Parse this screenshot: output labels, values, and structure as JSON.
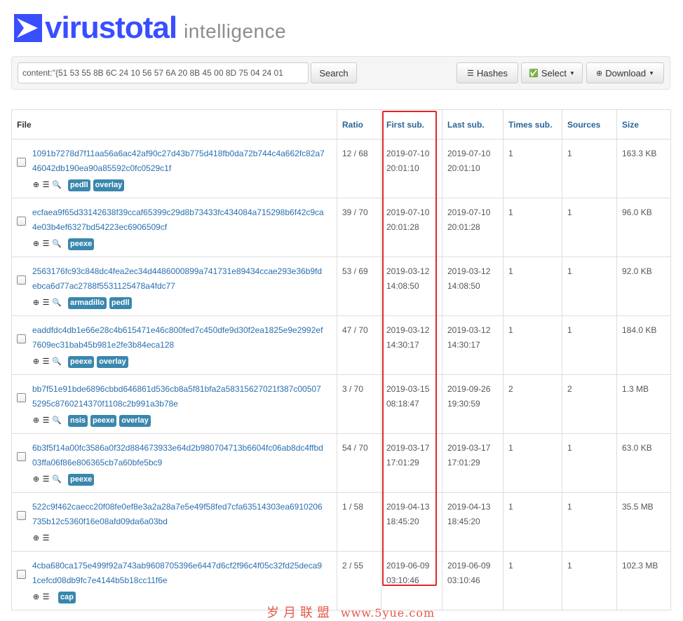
{
  "brand": {
    "name_part1": "virus",
    "name_part2": "total",
    "product": "intelligence",
    "colors": {
      "primary": "#394EFF",
      "secondary": "#8c8c8c"
    }
  },
  "search": {
    "query": "content:\"{51 53 55 8B 6C 24 10 56 57 6A 20 8B 45 00 8D 75 04 24 01",
    "button_label": "Search"
  },
  "toolbar": {
    "hashes_label": "Hashes",
    "select_label": "Select",
    "download_label": "Download"
  },
  "table": {
    "headers": {
      "file": "File",
      "ratio": "Ratio",
      "first_sub": "First sub.",
      "last_sub": "Last sub.",
      "times_sub": "Times sub.",
      "sources": "Sources",
      "size": "Size"
    },
    "rows": [
      {
        "hash": "1091b7278d7f11aa56a6ac42af90c27d43b775d418fb0da72b744c4a662fc82a746042db190ea90a85592c0fc0529c1f",
        "tags": [
          "pedll",
          "overlay"
        ],
        "has_search": true,
        "ratio": "12 / 68",
        "first_date": "2019-07-10",
        "first_time": "20:01:10",
        "last_date": "2019-07-10",
        "last_time": "20:01:10",
        "times": "1",
        "sources": "1",
        "size": "163.3 KB"
      },
      {
        "hash": "ecfaea9f65d33142638f39ccaf65399c29d8b73433fc434084a715298b6f42c9ca4e03b4ef6327bd54223ec6906509cf",
        "tags": [
          "peexe"
        ],
        "has_search": true,
        "ratio": "39 / 70",
        "first_date": "2019-07-10",
        "first_time": "20:01:28",
        "last_date": "2019-07-10",
        "last_time": "20:01:28",
        "times": "1",
        "sources": "1",
        "size": "96.0 KB"
      },
      {
        "hash": "2563176fc93c848dc4fea2ec34d4486000899a741731e89434ccae293e36b9fdebca6d77ac2788f5531125478a4fdc77",
        "tags": [
          "armadillo",
          "pedll"
        ],
        "has_search": true,
        "ratio": "53 / 69",
        "first_date": "2019-03-12",
        "first_time": "14:08:50",
        "last_date": "2019-03-12",
        "last_time": "14:08:50",
        "times": "1",
        "sources": "1",
        "size": "92.0 KB"
      },
      {
        "hash": "eaddfdc4db1e66e28c4b615471e46c800fed7c450dfe9d30f2ea1825e9e2992ef7609ec31bab45b981e2fe3b84eca128",
        "tags": [
          "peexe",
          "overlay"
        ],
        "has_search": true,
        "ratio": "47 / 70",
        "first_date": "2019-03-12",
        "first_time": "14:30:17",
        "last_date": "2019-03-12",
        "last_time": "14:30:17",
        "times": "1",
        "sources": "1",
        "size": "184.0 KB"
      },
      {
        "hash": "bb7f51e91bde6896cbbd646861d536cb8a5f81bfa2a58315627021f387c005075295c8760214370f1108c2b991a3b78e",
        "tags": [
          "nsis",
          "peexe",
          "overlay"
        ],
        "has_search": true,
        "ratio": "3 / 70",
        "first_date": "2019-03-15",
        "first_time": "08:18:47",
        "last_date": "2019-09-26",
        "last_time": "19:30:59",
        "times": "2",
        "sources": "2",
        "size": "1.3 MB"
      },
      {
        "hash": "6b3f5f14a00fc3586a0f32d884673933e64d2b980704713b6604fc06ab8dc4ffbd03ffa06f86e806365cb7a60bfe5bc9",
        "tags": [
          "peexe"
        ],
        "has_search": true,
        "ratio": "54 / 70",
        "first_date": "2019-03-17",
        "first_time": "17:01:29",
        "last_date": "2019-03-17",
        "last_time": "17:01:29",
        "times": "1",
        "sources": "1",
        "size": "63.0 KB"
      },
      {
        "hash": "522c9f462caecc20f08fe0ef8e3a2a28a7e5e49f58fed7cfa63514303ea6910206735b12c5360f16e08afd09da6a03bd",
        "tags": [],
        "has_search": false,
        "ratio": "1 / 58",
        "first_date": "2019-04-13",
        "first_time": "18:45:20",
        "last_date": "2019-04-13",
        "last_time": "18:45:20",
        "times": "1",
        "sources": "1",
        "size": "35.5 MB"
      },
      {
        "hash": "4cba680ca175e499f92a743ab9608705396e6447d6cf2f96c4f05c32fd25deca91cefcd08db9fc7e4144b5b18cc11f6e",
        "tags": [
          "cap"
        ],
        "has_search": false,
        "ratio": "2 / 55",
        "first_date": "2019-06-09",
        "first_time": "03:10:46",
        "last_date": "2019-06-09",
        "last_time": "03:10:46",
        "times": "1",
        "sources": "1",
        "size": "102.3 MB"
      }
    ]
  },
  "watermark": {
    "text": "岁月联盟",
    "url": "www.5yue.com"
  },
  "icons": {
    "download": "download-icon",
    "details": "list-icon",
    "search": "search-icon",
    "hashes": "list-icon",
    "select": "check-circle-icon",
    "download_btn": "download-circle-icon"
  },
  "highlight_color": "#e0262c"
}
